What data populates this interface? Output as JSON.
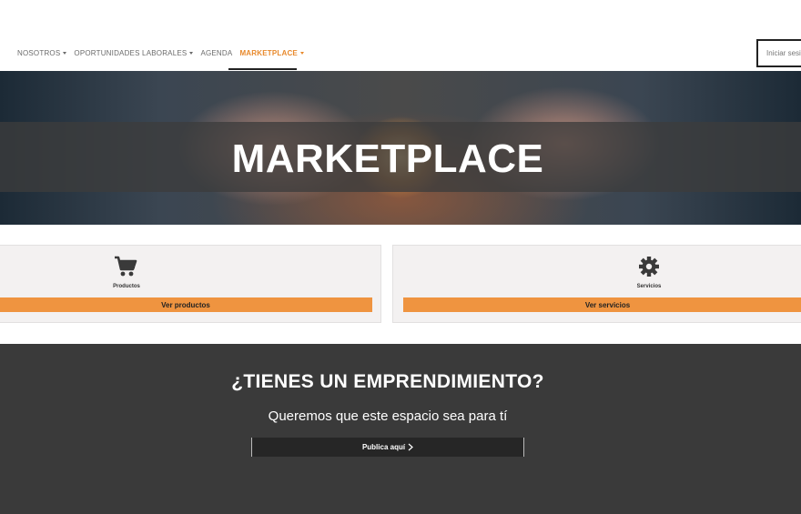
{
  "nav": {
    "items": [
      {
        "label": "NOSOTROS",
        "has_caret": true
      },
      {
        "label": "OPORTUNIDADES LABORALES",
        "has_caret": true
      },
      {
        "label": "AGENDA",
        "has_caret": false
      },
      {
        "label": "MARKETPLACE",
        "has_caret": true,
        "active": true
      }
    ],
    "login_label": "Iniciar sesión",
    "accent_color": "#e8892c"
  },
  "hero": {
    "title": "MARKETPLACE"
  },
  "cards": [
    {
      "icon": "shopping-cart-icon",
      "label": "Productos",
      "button_label": "Ver productos"
    },
    {
      "icon": "gear-icon",
      "label": "Servicios",
      "button_label": "Ver servicios"
    }
  ],
  "cta": {
    "heading": "¿TIENES UN EMPRENDIMIENTO?",
    "subheading": "Queremos que este espacio sea para tí",
    "button_label": "Publica aquí",
    "button_icon": "chevron-right-icon"
  },
  "colors": {
    "orange": "#ef9440",
    "dark_section": "#3a3a3a",
    "card_bg": "#f3f1f1"
  }
}
